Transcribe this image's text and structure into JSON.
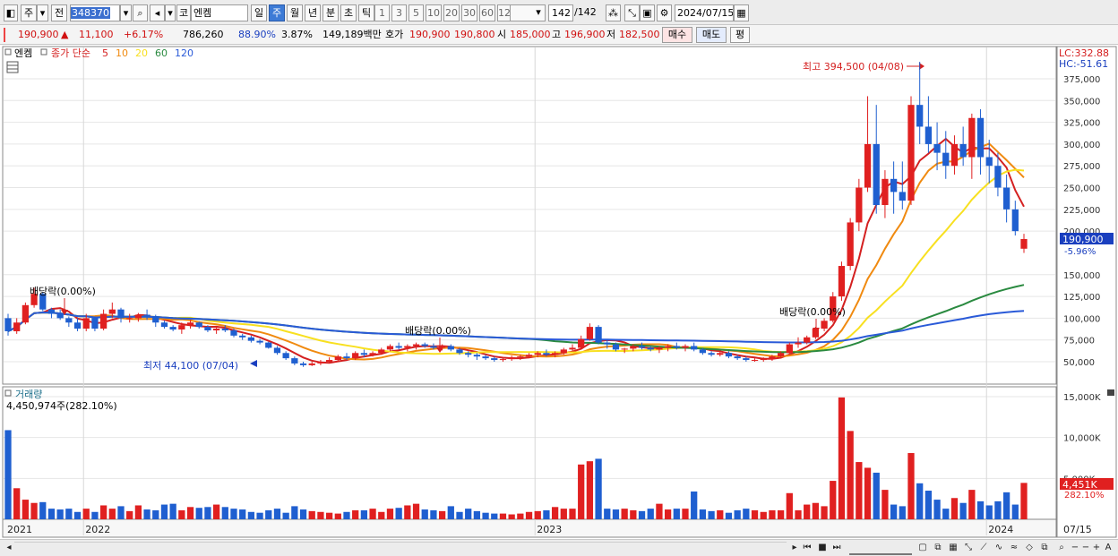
{
  "toolbar": {
    "market_type": "주",
    "prev_label": "전",
    "stock_code": "348370",
    "search_icon": "search-icon",
    "market": "코",
    "stock_name": "엔켐",
    "periods": [
      "일",
      "주",
      "월",
      "년",
      "분",
      "초",
      "틱"
    ],
    "active_period": "주",
    "intervals": [
      "1",
      "3",
      "5",
      "10",
      "20",
      "30",
      "60",
      "120"
    ],
    "count": "142",
    "count_total": "/142",
    "date": "2024/07/15"
  },
  "quote": {
    "price": "190,900",
    "change_arrow": "▲",
    "change": "11,100",
    "change_pct": "+6.17%",
    "volume": "786,260",
    "vol_ratio": "88.90%",
    "turnover": "3.87%",
    "amount": "149,189백만",
    "hoga_label": "호가",
    "ask": "190,900",
    "bid": "190,800",
    "open_label": "시",
    "open": "185,000",
    "high_label": "고",
    "high": "196,900",
    "low_label": "저",
    "low": "182,500",
    "buy_label": "매수",
    "sell_label": "매도",
    "eval_label": "평"
  },
  "price_panel": {
    "stock_label": "엔켐",
    "ma_label": "종가 단순",
    "ma_periods": [
      "5",
      "10",
      "20",
      "60",
      "120"
    ],
    "ma_colors": [
      "#d42020",
      "#f08a10",
      "#f8e020",
      "#2a8a40",
      "#2a5ad8"
    ],
    "lc": "LC:332.88",
    "hc": "HC:-51.61",
    "high_note": "최고 394,500 (04/08)",
    "low_note": "최저 44,100 (07/04)",
    "dividend_notes": [
      "배당락(0.00%)",
      "배당락(0.00%)",
      "배당락(0.00%)"
    ],
    "last_price_tag": "190,900",
    "last_change_tag": "-5.96%",
    "y_ticks": [
      "375,000",
      "350,000",
      "325,000",
      "300,000",
      "275,000",
      "250,000",
      "225,000",
      "200,000",
      "150,000",
      "125,000",
      "100,000",
      "75,000",
      "50,000"
    ]
  },
  "volume_panel": {
    "title": "거래량",
    "last_volume": "4,450,974주(282.10%)",
    "y_ticks": [
      "15,000K",
      "10,000K",
      "5,000K"
    ],
    "last_tag": "4,451K",
    "last_pct": "282.10%"
  },
  "x_axis": {
    "labels": [
      "2021",
      "2022",
      "2023",
      "2024",
      "07/15"
    ]
  },
  "chart_data": {
    "type": "candlestick",
    "symbol": "엔켐",
    "period": "weekly",
    "notes": "Approximate reconstruction of weekly OHLC. Prices in KRW.",
    "candles": [
      [
        100000,
        105000,
        80000,
        85000,
        10900
      ],
      [
        85000,
        100000,
        82000,
        95000,
        3800
      ],
      [
        95000,
        118000,
        93000,
        115000,
        2400
      ],
      [
        115000,
        135000,
        112000,
        128000,
        2000
      ],
      [
        128000,
        130000,
        108000,
        110000,
        2100
      ],
      [
        110000,
        112000,
        100000,
        105000,
        1300
      ],
      [
        105000,
        110000,
        98000,
        100000,
        1200
      ],
      [
        100000,
        102000,
        90000,
        95000,
        1300
      ],
      [
        95000,
        100000,
        85000,
        88000,
        900
      ],
      [
        88000,
        105000,
        85000,
        100000,
        1300
      ],
      [
        100000,
        102000,
        85000,
        88000,
        900
      ],
      [
        88000,
        110000,
        86000,
        105000,
        1700
      ],
      [
        105000,
        118000,
        100000,
        110000,
        1300
      ],
      [
        110000,
        112000,
        95000,
        100000,
        1600
      ],
      [
        100000,
        105000,
        95000,
        100000,
        1000
      ],
      [
        100000,
        106000,
        96000,
        104000,
        1700
      ],
      [
        104000,
        110000,
        98000,
        102000,
        1200
      ],
      [
        102000,
        104000,
        90000,
        95000,
        1100
      ],
      [
        95000,
        97000,
        88000,
        90000,
        1800
      ],
      [
        90000,
        92000,
        85000,
        87000,
        1900
      ],
      [
        87000,
        95000,
        82000,
        92000,
        1100
      ],
      [
        92000,
        98000,
        88000,
        95000,
        1500
      ],
      [
        95000,
        96000,
        88000,
        90000,
        1400
      ],
      [
        90000,
        92000,
        84000,
        86000,
        1500
      ],
      [
        86000,
        90000,
        82000,
        88000,
        1800
      ],
      [
        88000,
        92000,
        84000,
        86000,
        1500
      ],
      [
        86000,
        88000,
        78000,
        80000,
        1300
      ],
      [
        80000,
        82000,
        75000,
        78000,
        1200
      ],
      [
        78000,
        80000,
        72000,
        74000,
        900
      ],
      [
        74000,
        76000,
        70000,
        72000,
        800
      ],
      [
        72000,
        73000,
        65000,
        66000,
        1100
      ],
      [
        66000,
        68000,
        58000,
        60000,
        1300
      ],
      [
        60000,
        62000,
        52000,
        54000,
        800
      ],
      [
        54000,
        56000,
        46000,
        48000,
        1600
      ],
      [
        48000,
        50000,
        44100,
        46000,
        1200
      ],
      [
        46000,
        50000,
        45000,
        48000,
        1000
      ],
      [
        48000,
        52000,
        46000,
        50000,
        900
      ],
      [
        50000,
        55000,
        48000,
        52000,
        800
      ],
      [
        52000,
        58000,
        50000,
        56000,
        700
      ],
      [
        56000,
        60000,
        52000,
        54000,
        900
      ],
      [
        54000,
        62000,
        52000,
        60000,
        1100
      ],
      [
        60000,
        64000,
        55000,
        58000,
        1100
      ],
      [
        58000,
        62000,
        56000,
        60000,
        1300
      ],
      [
        60000,
        66000,
        58000,
        64000,
        900
      ],
      [
        64000,
        70000,
        62000,
        68000,
        1300
      ],
      [
        68000,
        72000,
        64000,
        66000,
        1400
      ],
      [
        66000,
        70000,
        62000,
        68000,
        1700
      ],
      [
        68000,
        72000,
        64000,
        70000,
        1900
      ],
      [
        70000,
        72000,
        66000,
        68000,
        1200
      ],
      [
        68000,
        71000,
        64000,
        66000,
        1100
      ],
      [
        66000,
        70000,
        63000,
        68000,
        1000
      ],
      [
        68000,
        70000,
        62000,
        64000,
        1600
      ],
      [
        64000,
        66000,
        58000,
        60000,
        900
      ],
      [
        60000,
        62000,
        55000,
        58000,
        1300
      ],
      [
        58000,
        60000,
        52000,
        56000,
        1000
      ],
      [
        56000,
        58000,
        52000,
        54000,
        800
      ],
      [
        54000,
        56000,
        50000,
        52000,
        700
      ],
      [
        52000,
        55000,
        50000,
        53000,
        700
      ],
      [
        53000,
        57000,
        51000,
        55000,
        600
      ],
      [
        55000,
        58000,
        52000,
        56000,
        700
      ],
      [
        56000,
        60000,
        54000,
        58000,
        900
      ],
      [
        58000,
        62000,
        55000,
        60000,
        1000
      ],
      [
        60000,
        64000,
        56000,
        58000,
        1100
      ],
      [
        58000,
        62000,
        55000,
        60000,
        1500
      ],
      [
        60000,
        66000,
        58000,
        64000,
        1300
      ],
      [
        64000,
        70000,
        62000,
        66000,
        1300
      ],
      [
        66000,
        80000,
        64000,
        76000,
        6700
      ],
      [
        76000,
        94000,
        74000,
        90000,
        7100
      ],
      [
        90000,
        92000,
        70000,
        72000,
        7400
      ],
      [
        72000,
        75000,
        65000,
        70000,
        1300
      ],
      [
        70000,
        72000,
        62000,
        64000,
        1200
      ],
      [
        64000,
        66000,
        60000,
        65000,
        1300
      ],
      [
        65000,
        70000,
        62000,
        68000,
        1100
      ],
      [
        68000,
        72000,
        64000,
        66000,
        1000
      ],
      [
        66000,
        68000,
        62000,
        64000,
        1300
      ],
      [
        64000,
        68000,
        60000,
        66000,
        1900
      ],
      [
        66000,
        70000,
        62000,
        68000,
        1200
      ],
      [
        68000,
        72000,
        64000,
        66000,
        1300
      ],
      [
        66000,
        70000,
        62000,
        68000,
        1300
      ],
      [
        68000,
        72000,
        62000,
        64000,
        3400
      ],
      [
        64000,
        66000,
        58000,
        60000,
        1200
      ],
      [
        60000,
        62000,
        56000,
        58000,
        1000
      ],
      [
        58000,
        62000,
        56000,
        60000,
        1100
      ],
      [
        60000,
        62000,
        54000,
        56000,
        800
      ],
      [
        56000,
        58000,
        52000,
        54000,
        1100
      ],
      [
        54000,
        56000,
        50000,
        52000,
        1300
      ],
      [
        52000,
        54000,
        50000,
        52000,
        1100
      ],
      [
        52000,
        55000,
        50000,
        53000,
        900
      ],
      [
        53000,
        58000,
        51000,
        56000,
        1100
      ],
      [
        56000,
        62000,
        54000,
        60000,
        1100
      ],
      [
        60000,
        72000,
        58000,
        70000,
        3200
      ],
      [
        70000,
        78000,
        66000,
        72000,
        1100
      ],
      [
        72000,
        80000,
        70000,
        78000,
        1800
      ],
      [
        78000,
        90000,
        76000,
        88000,
        2000
      ],
      [
        88000,
        100000,
        85000,
        97000,
        1600
      ],
      [
        97000,
        130000,
        95000,
        125000,
        4700
      ],
      [
        125000,
        165000,
        120000,
        160000,
        14900
      ],
      [
        160000,
        215000,
        155000,
        210000,
        10800
      ],
      [
        210000,
        260000,
        200000,
        250000,
        7000
      ],
      [
        250000,
        355000,
        245000,
        300000,
        6300
      ],
      [
        300000,
        345000,
        220000,
        230000,
        5700
      ],
      [
        230000,
        270000,
        215000,
        260000,
        3600
      ],
      [
        260000,
        280000,
        220000,
        245000,
        1800
      ],
      [
        245000,
        280000,
        225000,
        235000,
        1600
      ],
      [
        235000,
        355000,
        230000,
        345000,
        8100
      ],
      [
        345000,
        394500,
        300000,
        320000,
        4400
      ],
      [
        320000,
        355000,
        290000,
        300000,
        3500
      ],
      [
        300000,
        325000,
        270000,
        290000,
        2400
      ],
      [
        290000,
        315000,
        260000,
        275000,
        1300
      ],
      [
        275000,
        310000,
        265000,
        300000,
        2600
      ],
      [
        300000,
        320000,
        275000,
        285000,
        2000
      ],
      [
        285000,
        335000,
        260000,
        330000,
        3600
      ],
      [
        330000,
        340000,
        265000,
        285000,
        2200
      ],
      [
        285000,
        305000,
        255000,
        275000,
        1700
      ],
      [
        275000,
        290000,
        240000,
        250000,
        2200
      ],
      [
        250000,
        265000,
        210000,
        225000,
        3300
      ],
      [
        225000,
        235000,
        195000,
        200000,
        1800
      ],
      [
        179800,
        196900,
        175000,
        190900,
        4451
      ]
    ]
  }
}
